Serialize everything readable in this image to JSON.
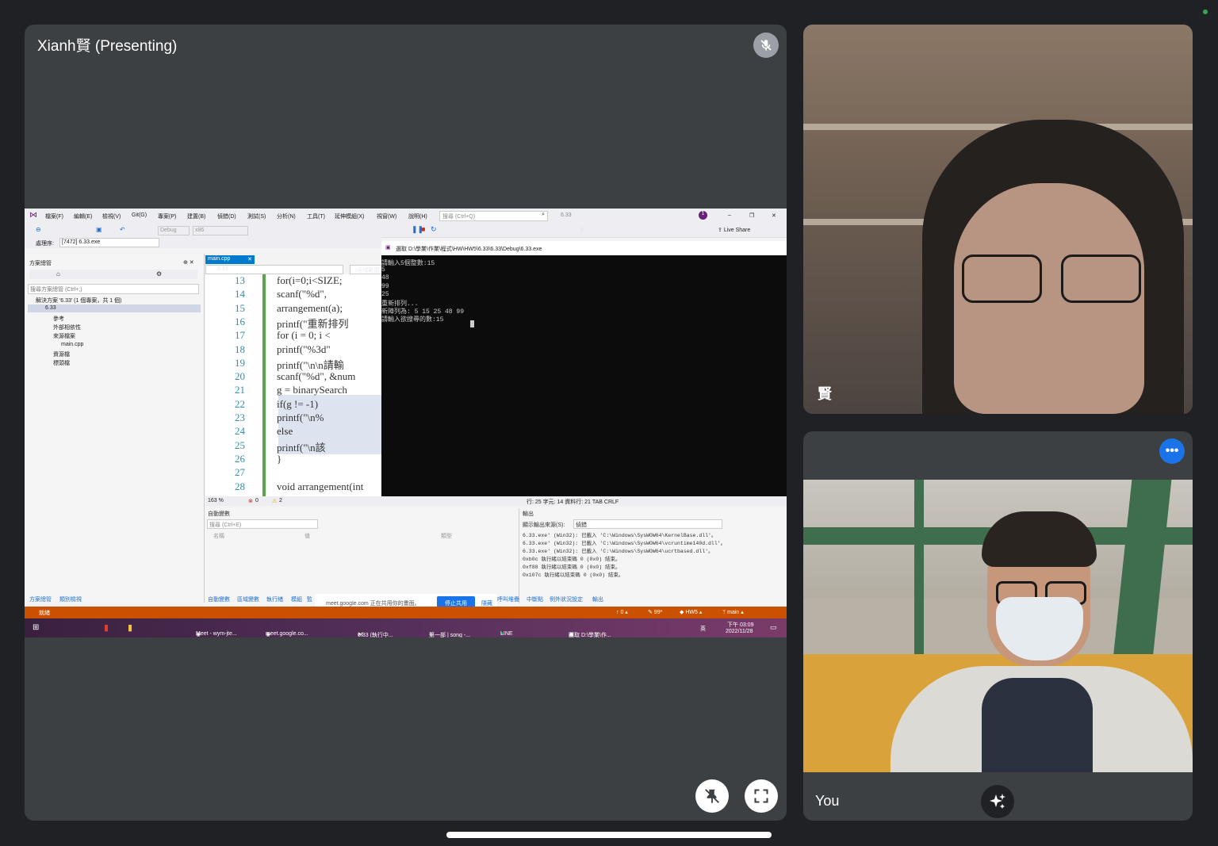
{
  "presenter": {
    "name": "Xianh賢 (Presenting)"
  },
  "vs": {
    "menu": [
      "檔案(F)",
      "編輯(E)",
      "檢視(V)",
      "Git(G)",
      "專案(P)",
      "建置(B)",
      "偵錯(D)",
      "測試(S)",
      "分析(N)",
      "工具(T)",
      "延伸模組(X)",
      "視窗(W)",
      "說明(H)"
    ],
    "search_placeholder": "搜尋 (Ctrl+Q)",
    "project_label": "6.33",
    "live_share": "Live Share",
    "process": "[7472] 6.33.exe",
    "config": "Debug",
    "platform": "x86",
    "solution_explorer_title": "方案總管",
    "solution_search": "搜尋方案總管 (Ctrl+;)",
    "tree": [
      "解決方案 '6.33' (1 個專案，共 1 個)",
      "6.33",
      "參考",
      "外部相依性",
      "來源檔案",
      "main.cpp",
      "資源檔",
      "標頭檔"
    ],
    "editor_tab": "main.cpp",
    "scope": "6.33",
    "scope_right": "(全域範圍)",
    "code_lines": [
      {
        "n": "13",
        "t": "for(i=0;i<SIZE;"
      },
      {
        "n": "14",
        "t": "    scanf(\"%d\","
      },
      {
        "n": "15",
        "t": "arrangement(a);"
      },
      {
        "n": "16",
        "t": "printf(\"重新排列"
      },
      {
        "n": "17",
        "t": "for (i = 0; i <"
      },
      {
        "n": "18",
        "t": "    printf(\"%3d\""
      },
      {
        "n": "19",
        "t": "printf(\"\\n\\n請輸"
      },
      {
        "n": "20",
        "t": "scanf(\"%d\", &num"
      },
      {
        "n": "21",
        "t": "g = binarySearch"
      },
      {
        "n": "22",
        "t": "if(g != -1)"
      },
      {
        "n": "23",
        "t": "    printf(\"\\n%"
      },
      {
        "n": "24",
        "t": "else"
      },
      {
        "n": "25",
        "t": "    printf(\"\\n該"
      },
      {
        "n": "26",
        "t": "}"
      },
      {
        "n": "27",
        "t": ""
      },
      {
        "n": "28",
        "t": "void arrangement(int"
      }
    ],
    "console_title": "選取 D:\\學業\\作業\\程式\\HW\\HW5\\6.33\\6.33\\Debug\\6.33.exe",
    "console_lines": [
      "請輸入5個整數:15",
      "5",
      "48",
      "99",
      "25",
      "重新排列...",
      "新陣列為:  5 15 25 48 99",
      "請輸入欲搜尋的數:15"
    ],
    "zoom": "163 %",
    "errors": "0",
    "warnings": "2",
    "cursor_pos": "行: 25    字元: 14    資料行: 21    TAB    CRLF",
    "auto_panel_title": "自動變數",
    "auto_search": "搜尋 (Ctrl+E)",
    "col_name": "名稱",
    "col_value": "值",
    "col_type": "類型",
    "output_title": "輸出",
    "output_source_label": "顯示輸出來源(S):",
    "output_source": "偵錯",
    "output_lines": [
      "6.33.exe' (Win32): 已載入 'C:\\Windows\\SysWOW64\\KernelBase.dll'。",
      "6.33.exe' (Win32): 已載入 'C:\\Windows\\SysWOW64\\vcruntime140d.dll'。",
      "6.33.exe' (Win32): 已載入 'C:\\Windows\\SysWOW64\\ucrtbased.dll'。",
      "0xb0c 執行緒以結束碼 0 (0x0) 結束。",
      "0xf88 執行緒以結束碼 0 (0x0) 結束。",
      "0x107c 執行緒以結束碼 0 (0x0) 結束。"
    ],
    "bottom_tabs_left": [
      "方案總管",
      "類別檢視"
    ],
    "bottom_tabs_mid": [
      "自動變數",
      "區域變數",
      "執行緒",
      "模組",
      "監"
    ],
    "bottom_tabs_right": [
      "呼叫堆疊",
      "中斷點",
      "例外狀況設定",
      "輸出"
    ],
    "share_notice": "meet.google.com 正在共用你的畫面。",
    "share_stop": "停止共用",
    "share_hide": "隱藏",
    "status_ready": "就緒",
    "status_right": [
      "↑ 0 ▴",
      "✎ 99*",
      "◆ HW5 ▴",
      "ᛘ main ▴"
    ],
    "taskbar_items": [
      "Meet - wym-jte...",
      "meet.google.co...",
      "6.33 (執行中...",
      "第一部 | song -...",
      "LINE",
      "選取 D:\\學業\\作..."
    ],
    "clock_time": "下午 03:09",
    "clock_date": "2022/11/28",
    "ime": "英"
  },
  "participants": [
    {
      "name": "賢"
    },
    {
      "name": "You"
    }
  ],
  "colors": {
    "accent": "#1a73e8",
    "tile": "#3c4043",
    "background": "#202124"
  }
}
